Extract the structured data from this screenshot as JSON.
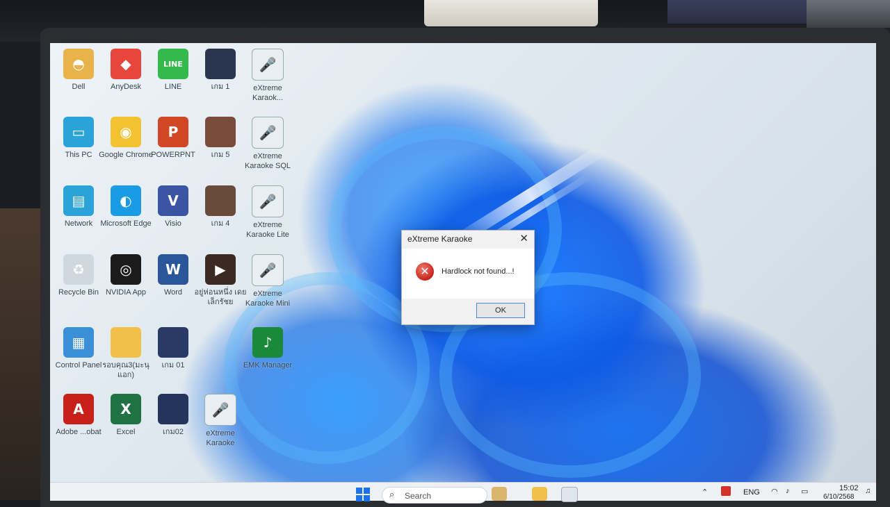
{
  "desktop": {
    "icons": [
      {
        "label": "Dell",
        "icon": "folder-person-icon",
        "color": "#e8b34a"
      },
      {
        "label": "AnyDesk",
        "icon": "anydesk-icon",
        "color": "#e8463c"
      },
      {
        "label": "LINE",
        "icon": "line-icon",
        "color": "#34b94a"
      },
      {
        "label": "เกม 1",
        "icon": "game-thumbnail-icon",
        "color": "#2a3550"
      },
      {
        "label": "eXtreme Karaok...",
        "icon": "extreme-karaoke-icon",
        "color": "#e9eef2"
      },
      {
        "label": "This PC",
        "icon": "monitor-icon",
        "color": "#2aa4d8"
      },
      {
        "label": "Google Chrome",
        "icon": "chrome-icon",
        "color": "#f2c230"
      },
      {
        "label": "POWERPNT",
        "icon": "powerpoint-icon",
        "color": "#d24726"
      },
      {
        "label": "เกม 5",
        "icon": "game-thumbnail-icon",
        "color": "#7a4a3a"
      },
      {
        "label": "eXtreme Karaoke SQL",
        "icon": "extreme-karaoke-icon",
        "color": "#e9eef2"
      },
      {
        "label": "Network",
        "icon": "network-icon",
        "color": "#2aa4d8"
      },
      {
        "label": "Microsoft Edge",
        "icon": "edge-icon",
        "color": "#1a9be6"
      },
      {
        "label": "Visio",
        "icon": "visio-icon",
        "color": "#3955a3"
      },
      {
        "label": "เกม 4",
        "icon": "game-thumbnail-icon",
        "color": "#6a4a3a"
      },
      {
        "label": "eXtreme Karaoke Lite",
        "icon": "extreme-karaoke-lite-icon",
        "color": "#e9eef2"
      },
      {
        "label": "Recycle Bin",
        "icon": "recycle-bin-icon",
        "color": "#cfd8df"
      },
      {
        "label": "NVIDIA App",
        "icon": "nvidia-icon",
        "color": "#1b1b1b"
      },
      {
        "label": "Word",
        "icon": "word-icon",
        "color": "#2b579a"
      },
      {
        "label": "อยู่ห่อนหนึ่ง เดย เล็กรัชย",
        "icon": "video-thumbnail-icon",
        "color": "#3a2a22"
      },
      {
        "label": "eXtreme Karaoke Mini",
        "icon": "extreme-karaoke-icon",
        "color": "#e9eef2"
      },
      {
        "label": "Control Panel",
        "icon": "control-panel-icon",
        "color": "#3a8fd8"
      },
      {
        "label": "รอบคุณ3(มะนุ แอก)",
        "icon": "folder-icon",
        "color": "#f0c04a"
      },
      {
        "label": "เกม 01",
        "icon": "game-thumbnail-icon",
        "color": "#2a3a66"
      },
      {
        "label": "EMK Manager",
        "icon": "emk-manager-icon",
        "color": "#1a8a3a"
      },
      {
        "label": "Adobe ...obat",
        "icon": "acrobat-icon",
        "color": "#c8201a"
      },
      {
        "label": "Excel",
        "icon": "excel-icon",
        "color": "#1f7244"
      },
      {
        "label": "เกม02",
        "icon": "game-thumbnail-icon",
        "color": "#24345a"
      },
      {
        "label": "eXtreme Karaoke",
        "icon": "extreme-karaoke-icon",
        "color": "#e9eef2"
      }
    ]
  },
  "dialog": {
    "title": "eXtreme Karaoke",
    "close_glyph": "✕",
    "message": "Hardlock not found...!",
    "ok_label": "OK",
    "error_glyph": "✕"
  },
  "taskbar": {
    "search_placeholder": "Search",
    "language": "ENG",
    "time": "15:02",
    "date": "6/10/2568"
  }
}
